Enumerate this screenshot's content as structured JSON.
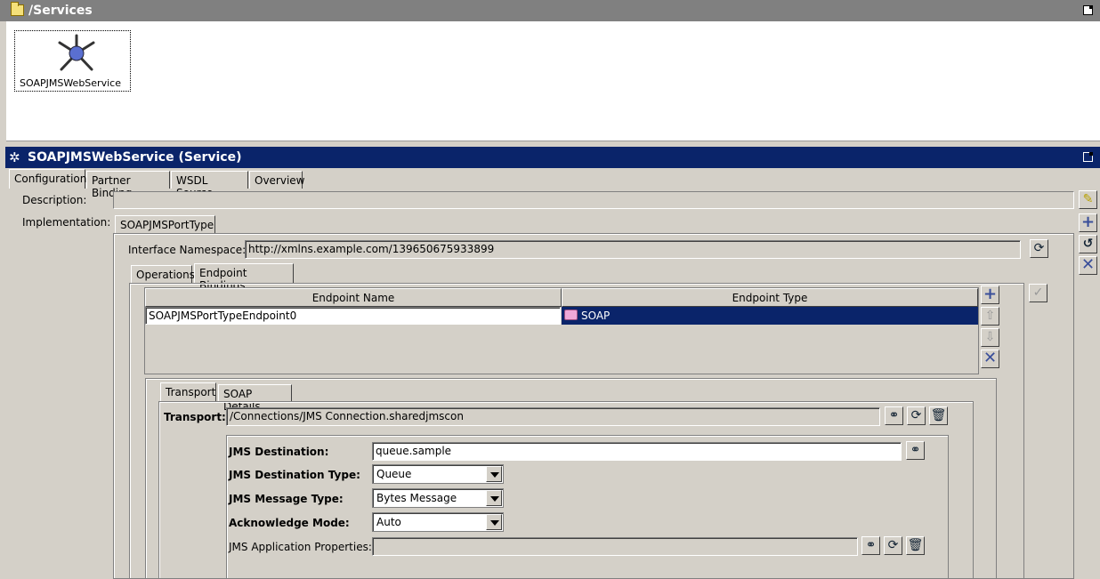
{
  "window": {
    "title": "/Services"
  },
  "canvas": {
    "service_label": "SOAPJMSWebService"
  },
  "service_header": {
    "title": "SOAPJMSWebService (Service)"
  },
  "tabs": [
    {
      "label": "Configuration",
      "selected": true
    },
    {
      "label": "Partner Binding"
    },
    {
      "label": "WSDL Source"
    },
    {
      "label": "Overview"
    }
  ],
  "config": {
    "description_label": "Description:",
    "description_value": "",
    "implementation_label": "Implementation:",
    "port_tab": "SOAPJMSPortType",
    "interface_ns_label": "Interface Namespace:",
    "interface_ns_value": "http://xmlns.example.com/139650675933899",
    "sub_tabs": [
      {
        "label": "Operations"
      },
      {
        "label": "Endpoint Bindings",
        "selected": true
      }
    ]
  },
  "endpoints": {
    "columns": [
      "Endpoint Name",
      "Endpoint Type"
    ],
    "rows": [
      {
        "name": "SOAPJMSPortTypeEndpoint0",
        "type": "SOAP"
      }
    ]
  },
  "binding_tabs": [
    {
      "label": "Transport",
      "selected": true
    },
    {
      "label": "SOAP Details"
    }
  ],
  "transport": {
    "label": "Transport:",
    "value": "/Connections/JMS Connection.sharedjmscon",
    "jms_destination_label": "JMS Destination:",
    "jms_destination_value": "queue.sample",
    "jms_destination_type_label": "JMS Destination Type:",
    "jms_destination_type_value": "Queue",
    "jms_message_type_label": "JMS Message Type:",
    "jms_message_type_value": "Bytes Message",
    "ack_mode_label": "Acknowledge Mode:",
    "ack_mode_value": "Auto",
    "jms_app_props_label": "JMS Application Properties:",
    "jms_app_props_value": ""
  },
  "icons": {
    "add": "plus-icon",
    "up": "arrow-up-icon",
    "down": "arrow-down-icon",
    "delete": "x-icon",
    "browse": "binoculars-icon",
    "refresh": "refresh-icon",
    "trash": "trash-icon",
    "edit": "pencil-icon",
    "apply": "checkmark-icon",
    "undo": "undo-icon"
  },
  "colors": {
    "header_bg": "#0a246a",
    "titlebar_bg": "#808080",
    "selection": "#0a246a"
  }
}
